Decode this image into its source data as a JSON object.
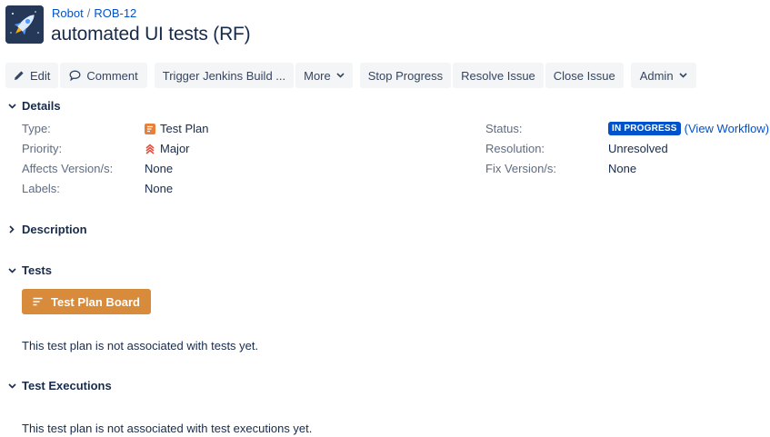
{
  "breadcrumb": {
    "project": "Robot",
    "separator": "/",
    "issue_key": "ROB-12"
  },
  "issue": {
    "title": "automated UI tests (RF)"
  },
  "toolbar": {
    "edit": "Edit",
    "comment": "Comment",
    "trigger": "Trigger Jenkins Build ...",
    "more": "More",
    "stop_progress": "Stop Progress",
    "resolve": "Resolve Issue",
    "close": "Close Issue",
    "admin": "Admin"
  },
  "details": {
    "heading": "Details",
    "type_label": "Type:",
    "type_value": "Test Plan",
    "priority_label": "Priority:",
    "priority_value": "Major",
    "affects_label": "Affects Version/s:",
    "affects_value": "None",
    "labels_label": "Labels:",
    "labels_value": "None",
    "status_label": "Status:",
    "status_value": "IN PROGRESS",
    "workflow_link": "(View Workflow)",
    "resolution_label": "Resolution:",
    "resolution_value": "Unresolved",
    "fix_label": "Fix Version/s:",
    "fix_value": "None"
  },
  "description": {
    "heading": "Description"
  },
  "tests": {
    "heading": "Tests",
    "board_button": "Test Plan Board",
    "empty_text": "This test plan is not associated with tests yet."
  },
  "executions": {
    "heading": "Test Executions",
    "empty_text": "This test plan is not associated with test executions yet."
  },
  "colors": {
    "link": "#0052cc",
    "status_lozenge": "#0052cc",
    "board_button": "#d98b3c",
    "priority_major": "#e5493a",
    "test_plan_icon": "#e8803a",
    "project_avatar": "#253858"
  },
  "icons": {
    "project": "rocket-icon",
    "edit": "pencil-icon",
    "comment": "speech-bubble-icon",
    "dropdown": "chevron-down-icon",
    "expanded": "chevron-down-icon",
    "collapsed": "chevron-right-icon",
    "type": "test-plan-icon",
    "priority": "priority-major-icon",
    "board": "board-lines-icon"
  }
}
